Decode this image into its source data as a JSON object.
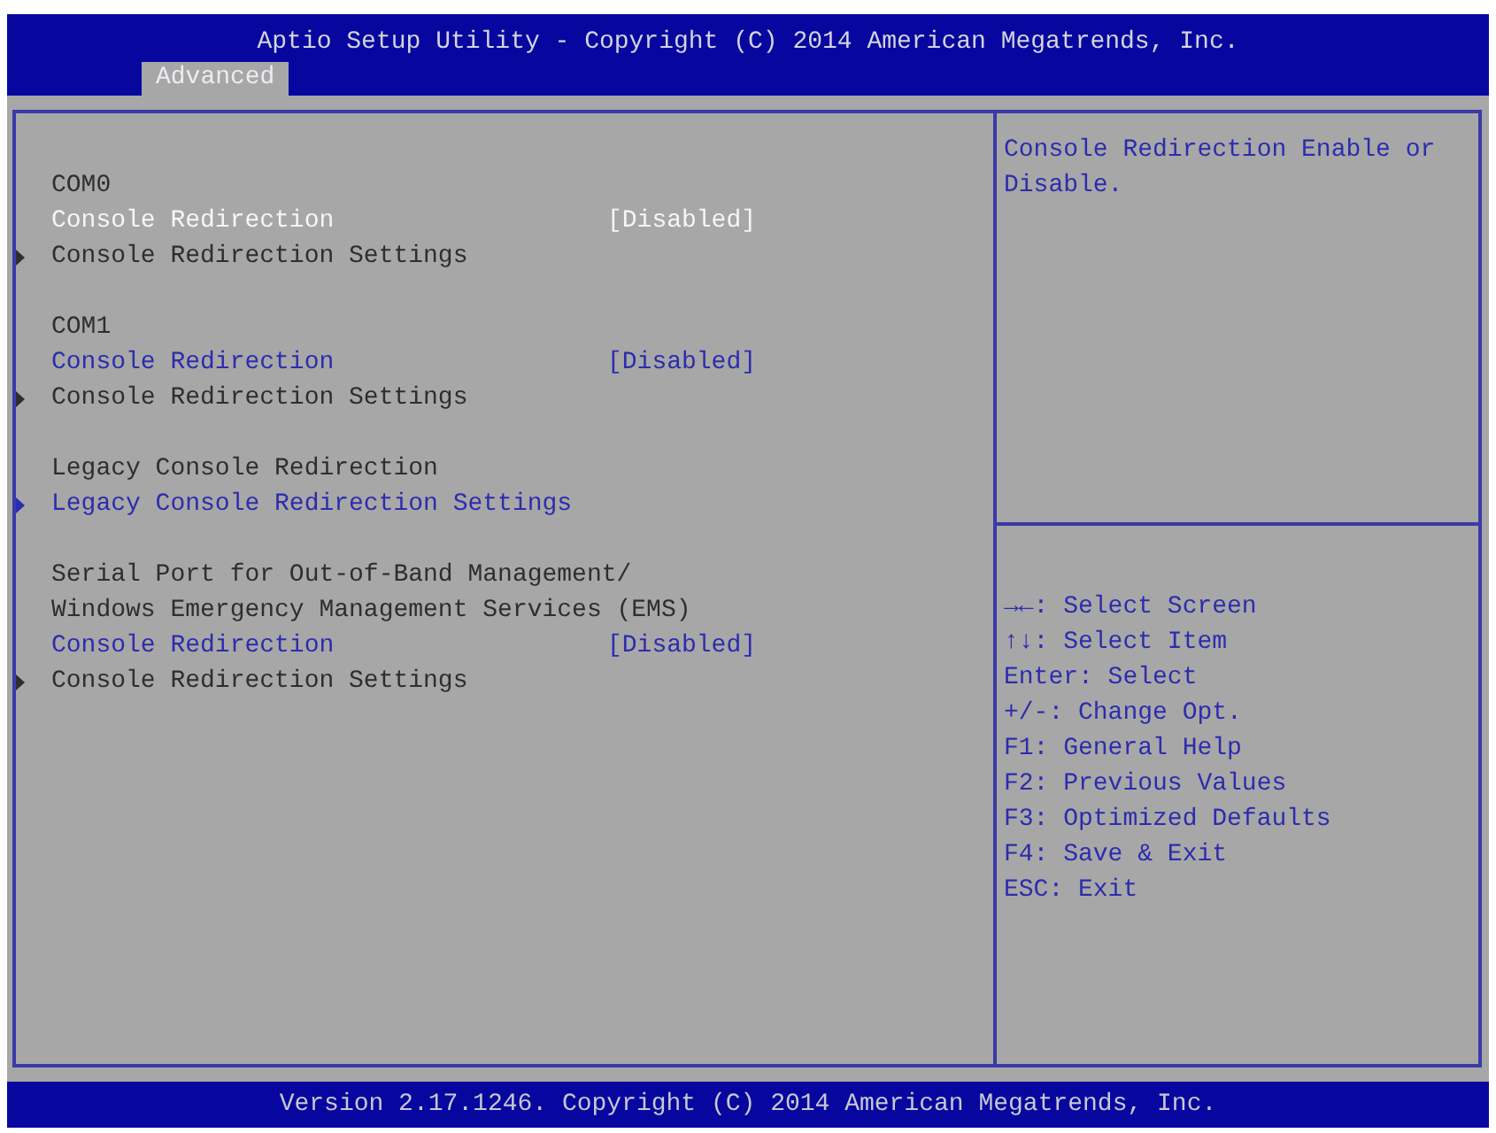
{
  "header": {
    "title": "Aptio Setup Utility - Copyright (C) 2014 American Megatrends, Inc.",
    "tabs": [
      {
        "label": "Advanced",
        "selected": true
      }
    ]
  },
  "menu": {
    "groups": [
      {
        "items": [
          {
            "kind": "heading",
            "label": "COM0",
            "selected": false
          },
          {
            "kind": "option",
            "label": "Console Redirection",
            "value": "[Disabled]",
            "selected": true,
            "disabled": false
          },
          {
            "kind": "submenu",
            "label": "Console Redirection Settings",
            "selected": false,
            "disabled": true
          }
        ]
      },
      {
        "items": [
          {
            "kind": "heading",
            "label": "COM1",
            "selected": false
          },
          {
            "kind": "option",
            "label": "Console Redirection",
            "value": "[Disabled]",
            "selected": false,
            "disabled": false
          },
          {
            "kind": "submenu",
            "label": "Console Redirection Settings",
            "selected": false,
            "disabled": true
          }
        ]
      },
      {
        "items": [
          {
            "kind": "heading",
            "label": "Legacy Console Redirection",
            "selected": false
          },
          {
            "kind": "submenu",
            "label": "Legacy Console Redirection Settings",
            "selected": false,
            "disabled": false
          }
        ]
      },
      {
        "items": [
          {
            "kind": "heading",
            "label": "Serial Port for Out-of-Band Management/",
            "selected": false
          },
          {
            "kind": "heading",
            "label": "Windows Emergency Management Services (EMS)",
            "selected": false
          },
          {
            "kind": "option",
            "label": "Console Redirection",
            "value": "[Disabled]",
            "selected": false,
            "disabled": false
          },
          {
            "kind": "submenu",
            "label": "Console Redirection Settings",
            "selected": false,
            "disabled": true
          }
        ]
      }
    ]
  },
  "help": {
    "text": "Console Redirection Enable or Disable.",
    "keys": [
      "→←: Select Screen",
      "↑↓: Select Item",
      "Enter: Select",
      "+/-: Change Opt.",
      "F1: General Help",
      "F2: Previous Values",
      "F3: Optimized Defaults",
      "F4: Save & Exit",
      "ESC: Exit"
    ]
  },
  "footer": {
    "text": "Version 2.17.1246. Copyright (C) 2014 American Megatrends, Inc."
  }
}
